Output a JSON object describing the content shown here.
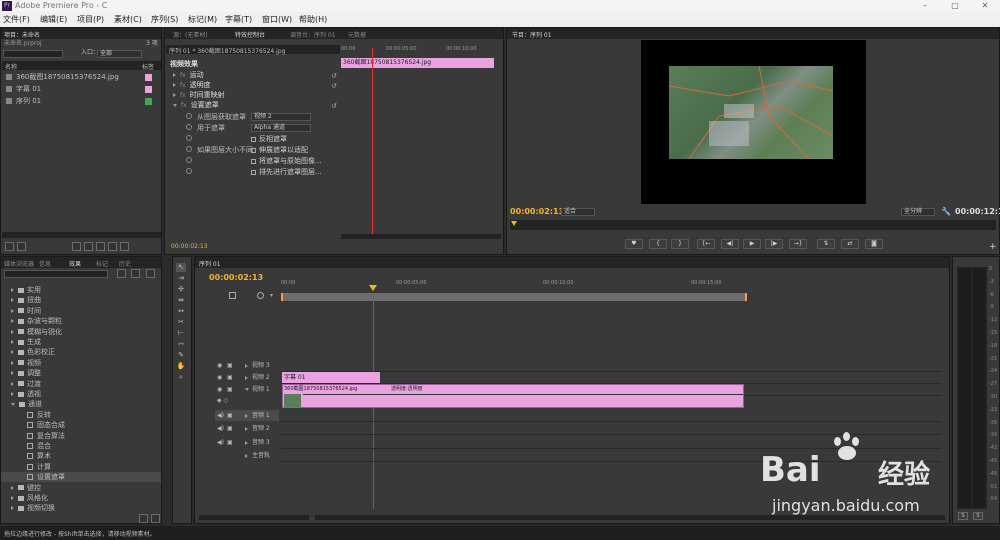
{
  "app": {
    "title": "Adobe Premiere Pro - C",
    "logo": "Pr"
  },
  "menu": [
    "文件(F)",
    "编辑(E)",
    "项目(P)",
    "素材(C)",
    "序列(S)",
    "标记(M)",
    "字幕(T)",
    "窗口(W)",
    "帮助(H)"
  ],
  "project": {
    "tab": "项目：未命名",
    "file": "未命名.prproj",
    "count": "3 项",
    "in_label": "入口：",
    "in_value": "全部",
    "col_name": "名称",
    "col_label": "标签",
    "items": [
      {
        "name": "360截图18750815376524.jpg",
        "color": "#e8a3e0"
      },
      {
        "name": "字幕 01",
        "color": "#e8a3e0"
      },
      {
        "name": "序列 01",
        "color": "#3faa4c"
      }
    ]
  },
  "source_tabs": [
    "源：(无素材)",
    "特效控制台",
    "调音台：序列 01",
    "元数据"
  ],
  "effect_controls": {
    "header": "序列 01 * 360截图18750815376524.jpg",
    "section": "视频效果",
    "ruler": [
      "00:00",
      "00:00:05:00",
      "00:00:10:00"
    ],
    "clip": "360截图18750815376524.jpg",
    "effects": [
      "运动",
      "透明度",
      "时间重映射",
      "设置遮罩"
    ],
    "props": [
      {
        "label": "从图层获取遮罩",
        "value": "视频 2"
      },
      {
        "label": "用于遮罩",
        "value": "Alpha 通道"
      },
      {
        "label": "",
        "value": "反相遮罩"
      },
      {
        "label": "如果图层大小不同",
        "value": "伸展遮罩以适配"
      },
      {
        "label": "",
        "value": "将遮罩与原始图像..."
      },
      {
        "label": "",
        "value": "排先进行遮罩图层..."
      }
    ],
    "timecode": "00:00:02:13"
  },
  "program": {
    "tab": "节目：序列 01",
    "timecode": "00:00:02:13",
    "fit": "适合",
    "quality": "全分辨",
    "duration": "00:00:12:19"
  },
  "effects_panel": {
    "tabs": [
      "媒体浏览器",
      "信息",
      "效果",
      "标记",
      "历史"
    ],
    "items": [
      {
        "t": "f",
        "n": "实用"
      },
      {
        "t": "f",
        "n": "扭曲"
      },
      {
        "t": "f",
        "n": "时间"
      },
      {
        "t": "f",
        "n": "杂波与颗粒"
      },
      {
        "t": "f",
        "n": "模糊与锐化"
      },
      {
        "t": "f",
        "n": "生成"
      },
      {
        "t": "f",
        "n": "色彩校正"
      },
      {
        "t": "f",
        "n": "视频"
      },
      {
        "t": "f",
        "n": "调整"
      },
      {
        "t": "f",
        "n": "过渡"
      },
      {
        "t": "f",
        "n": "透视"
      },
      {
        "t": "o",
        "n": "通道"
      },
      {
        "t": "c",
        "n": "反转"
      },
      {
        "t": "c",
        "n": "固态合成"
      },
      {
        "t": "c",
        "n": "复合算法"
      },
      {
        "t": "c",
        "n": "混合"
      },
      {
        "t": "c",
        "n": "算术"
      },
      {
        "t": "c",
        "n": "计算"
      },
      {
        "t": "c",
        "n": "设置遮罩"
      },
      {
        "t": "f",
        "n": "键控"
      },
      {
        "t": "f",
        "n": "风格化"
      },
      {
        "t": "f",
        "n": "视频切换"
      }
    ]
  },
  "timeline": {
    "tab": "序列 01",
    "timecode": "00:00:02:13",
    "ruler": [
      "00:00",
      "00:00:05:00",
      "00:00:10:00",
      "00:00:15:00"
    ],
    "tracks": [
      {
        "name": "视频 3"
      },
      {
        "name": "视频 2"
      },
      {
        "name": "视频 1"
      },
      {
        "name": "音频 1"
      },
      {
        "name": "音频 2"
      },
      {
        "name": "音频 3"
      },
      {
        "name": "主音轨"
      }
    ],
    "clip_v2": "字幕 01",
    "clip_v1": "360截图18750815376524.jpg",
    "clip_v1_fx": "透明度:透明度"
  },
  "meter_scale": [
    "0",
    "-3",
    "-6",
    "-9",
    "-12",
    "-15",
    "-18",
    "-21",
    "-24",
    "-27",
    "-30",
    "-33",
    "-36",
    "-39",
    "-42",
    "-45",
    "-48",
    "-51",
    "-54"
  ],
  "status": "拖拉边缘进行修改 - 按Shift单击选择，请移动视频素材。",
  "watermark": {
    "brand": "Bai",
    "brand2": "经验",
    "url": "jingyan.baidu.com"
  }
}
